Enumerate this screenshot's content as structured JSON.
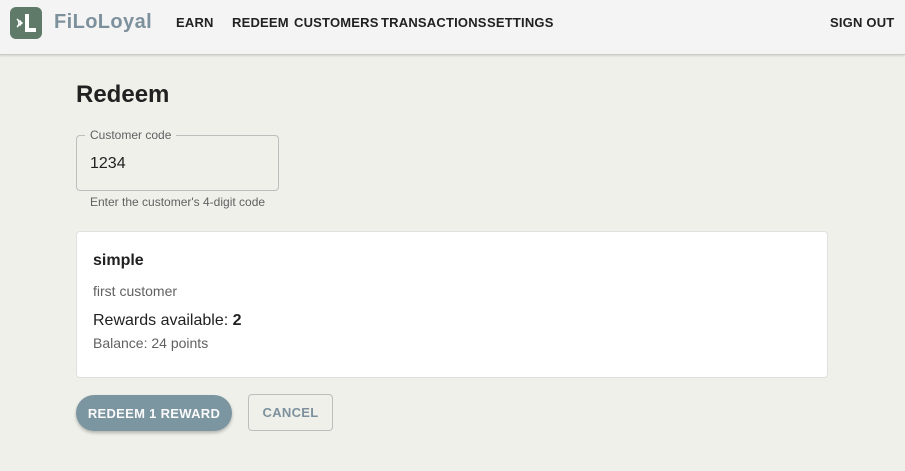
{
  "app": {
    "brand": "FiLoLoyal",
    "logo_icon": "filoloyal-logo-icon",
    "accent": "#5f7a69"
  },
  "nav": {
    "earn": "EARN",
    "redeem": "REDEEM",
    "customers": "CUSTOMERS",
    "transactions": "TRANSACTIONS",
    "settings": "SETTINGS",
    "sign_out": "SIGN OUT"
  },
  "page": {
    "title": "Redeem"
  },
  "customer_code": {
    "label": "Customer code",
    "value": "1234",
    "helper": "Enter the customer's 4-digit code"
  },
  "customer": {
    "name": "simple",
    "description": "first customer",
    "rewards_label": "Rewards available: ",
    "rewards_value": "2",
    "balance": "Balance: 24 points"
  },
  "actions": {
    "redeem": "REDEEM 1 REWARD",
    "cancel": "CANCEL"
  }
}
